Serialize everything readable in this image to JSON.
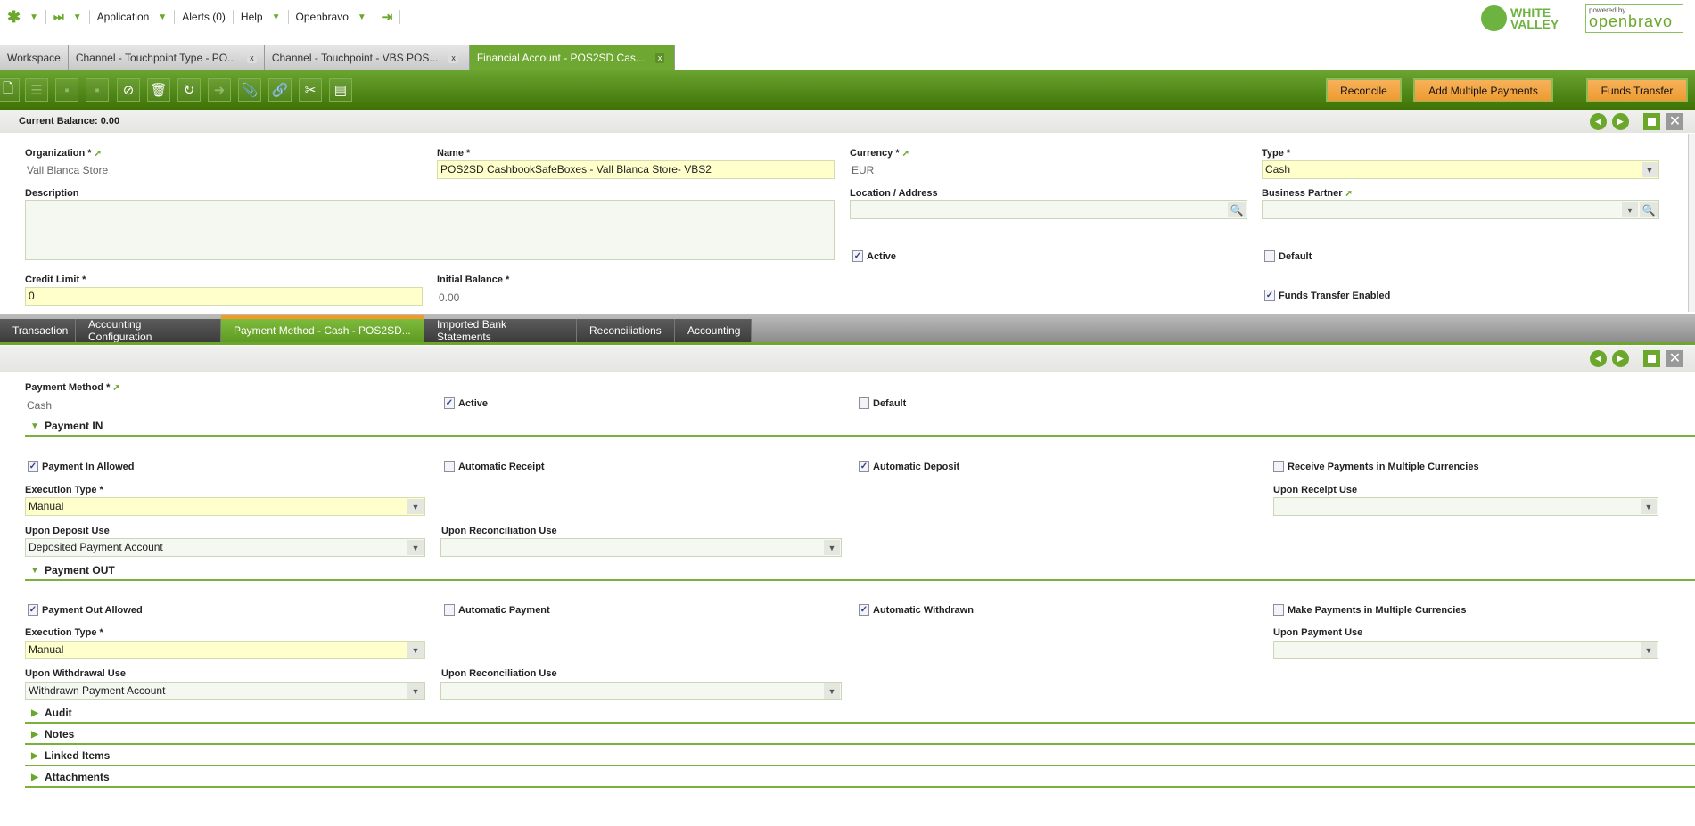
{
  "topmenu": {
    "items": [
      "Application",
      "Alerts (0)",
      "Help",
      "Openbravo"
    ]
  },
  "logos": {
    "brand": "WHITE VALLEY",
    "powered": "powered by",
    "openbravo": "openbravo"
  },
  "tabs": [
    {
      "label": "Workspace"
    },
    {
      "label": "Channel - Touchpoint Type - PO...",
      "close": "x"
    },
    {
      "label": "Channel - Touchpoint - VBS POS...",
      "close": "x"
    },
    {
      "label": "Financial Account - POS2SD Cas...",
      "close": "x"
    }
  ],
  "toolbar": {
    "reconcile": "Reconcile",
    "add_multiple": "Add Multiple Payments",
    "funds_transfer": "Funds Transfer"
  },
  "header": {
    "current_balance": "Current Balance: 0.00"
  },
  "form": {
    "organization_label": "Organization *",
    "organization_value": "Vall Blanca Store",
    "name_label": "Name *",
    "name_value": "POS2SD CashbookSafeBoxes - Vall Blanca Store- VBS2",
    "currency_label": "Currency *",
    "currency_value": "EUR",
    "type_label": "Type *",
    "type_value": "Cash",
    "description_label": "Description",
    "description_value": "",
    "location_label": "Location / Address",
    "location_value": "",
    "bpartner_label": "Business Partner",
    "bpartner_value": "",
    "active_label": "Active",
    "active": true,
    "default_label": "Default",
    "default": false,
    "credit_limit_label": "Credit Limit *",
    "credit_limit_value": "0",
    "initial_balance_label": "Initial Balance *",
    "initial_balance_value": "0.00",
    "funds_transfer_label": "Funds Transfer Enabled",
    "funds_transfer": true
  },
  "subtabs": [
    "Transaction",
    "Accounting Configuration",
    "Payment Method - Cash - POS2SD...",
    "Imported Bank Statements",
    "Reconciliations",
    "Accounting"
  ],
  "pm": {
    "payment_method_label": "Payment Method *",
    "payment_method_value": "Cash",
    "active_label": "Active",
    "default_label": "Default",
    "in_section": "Payment IN",
    "in_allowed": "Payment In Allowed",
    "auto_receipt": "Automatic Receipt",
    "auto_deposit": "Automatic Deposit",
    "recv_multi": "Receive Payments in Multiple Currencies",
    "in_exec_label": "Execution Type *",
    "in_exec_value": "Manual",
    "upon_receipt_label": "Upon Receipt Use",
    "upon_receipt_value": "",
    "upon_deposit_label": "Upon Deposit Use",
    "upon_deposit_value": "Deposited Payment Account",
    "in_recon_label": "Upon Reconciliation Use",
    "in_recon_value": "",
    "out_section": "Payment OUT",
    "out_allowed": "Payment Out Allowed",
    "auto_payment": "Automatic Payment",
    "auto_withdrawn": "Automatic Withdrawn",
    "make_multi": "Make Payments in Multiple Currencies",
    "out_exec_label": "Execution Type *",
    "out_exec_value": "Manual",
    "upon_payment_label": "Upon Payment Use",
    "upon_payment_value": "",
    "upon_withdrawal_label": "Upon Withdrawal Use",
    "upon_withdrawal_value": "Withdrawn Payment Account",
    "out_recon_label": "Upon Reconciliation Use",
    "out_recon_value": "",
    "audit": "Audit",
    "notes": "Notes",
    "linked": "Linked Items",
    "attachments": "Attachments"
  }
}
